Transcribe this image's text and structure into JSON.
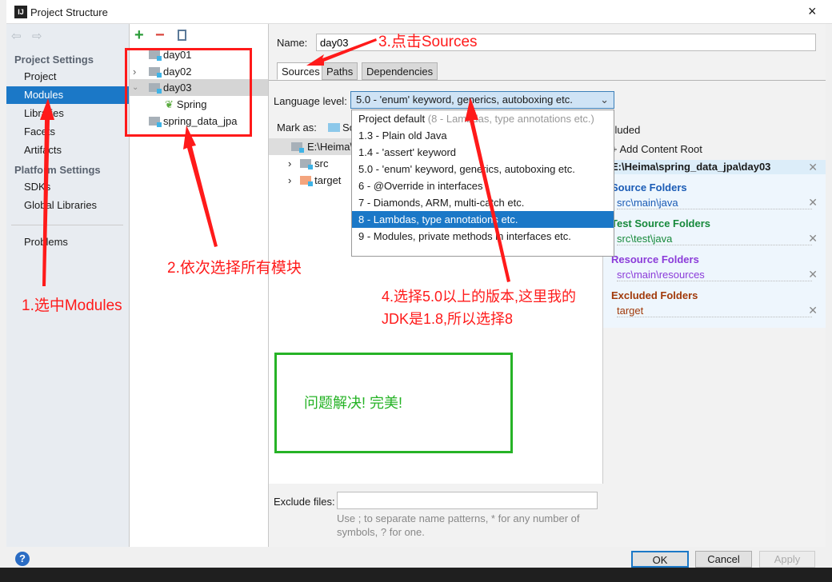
{
  "window": {
    "title": "Project Structure",
    "close": "×"
  },
  "nav": {
    "project_settings": "Project Settings",
    "items": [
      "Project",
      "Modules",
      "Libraries",
      "Facets",
      "Artifacts"
    ],
    "platform_settings": "Platform Settings",
    "platform_items": [
      "SDKs",
      "Global Libraries"
    ],
    "problems": "Problems",
    "selected": "Modules"
  },
  "modules": {
    "toolbar": {
      "add": "+",
      "remove": "−"
    },
    "items": [
      "day01",
      "day02",
      "day03",
      "Spring",
      "spring_data_jpa"
    ],
    "selected": "day03"
  },
  "main": {
    "name_label": "Name:",
    "name_value": "day03",
    "tabs": [
      "Sources",
      "Paths",
      "Dependencies"
    ],
    "active_tab": "Sources",
    "language_label": "Language level:",
    "language_value": "5.0 - 'enum' keyword, generics, autoboxing etc.",
    "mark_as": "Mark as:",
    "mark_so": "So",
    "excluded_partial": "cluded",
    "tree": [
      "E:\\Heima\\s",
      "src",
      "target"
    ],
    "dropdown": {
      "project_default": "Project default",
      "project_default_hint": "(8 - Lambdas, type annotations etc.)",
      "options": [
        "1.3 - Plain old Java",
        "1.4 - 'assert' keyword",
        "5.0 - 'enum' keyword, generics, autoboxing etc.",
        "6 - @Override in interfaces",
        "7 - Diamonds, ARM, multi-catch etc.",
        "8 - Lambdas, type annotations etc.",
        "9 - Modules, private methods in interfaces etc."
      ],
      "highlighted": "8 - Lambdas, type annotations etc."
    },
    "exclude_label": "Exclude files:",
    "exclude_value": "",
    "exclude_hint1": "Use ; to separate name patterns, * for any number of",
    "exclude_hint2": "symbols, ? for one."
  },
  "roots": {
    "add": "+ Add Content Root",
    "path": "E:\\Heima\\spring_data_jpa\\day03",
    "source_title": "Source Folders",
    "source": "src\\main\\java",
    "test_title": "Test Source Folders",
    "test": "src\\test\\java",
    "resource_title": "Resource Folders",
    "resource": "src\\main\\resources",
    "excluded_title": "Excluded Folders",
    "excluded": "target",
    "colors": {
      "source": "#1a5bb5",
      "test": "#16893a",
      "resource": "#8b3bd9",
      "excluded": "#a13a0a"
    }
  },
  "buttons": {
    "ok": "OK",
    "cancel": "Cancel",
    "apply": "Apply",
    "help": "?"
  },
  "annotations": {
    "a1": "1.选中Modules",
    "a2": "2.依次选择所有模块",
    "a3": "3.点击Sources",
    "a4_1": "4.选择5.0以上的版本,这里我的",
    "a4_2": "JDK是1.8,所以选择8",
    "note": "问题解决!  完美!"
  }
}
